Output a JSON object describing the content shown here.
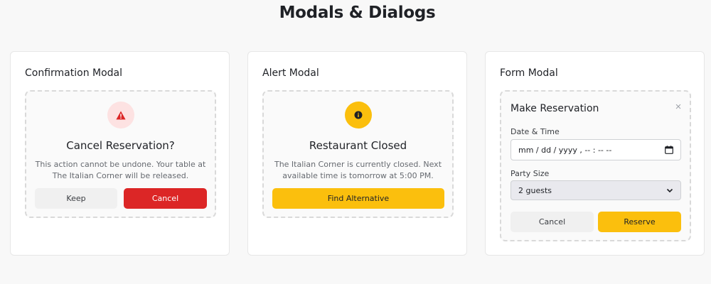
{
  "page": {
    "title": "Modals & Dialogs"
  },
  "confirmation": {
    "card_title": "Confirmation Modal",
    "icon": "warning-triangle-icon",
    "dialog_title": "Cancel Reservation?",
    "message": "This action cannot be undone. Your table at The Italian Corner will be released.",
    "keep_label": "Keep",
    "cancel_label": "Cancel",
    "colors": {
      "danger": "#dc2626",
      "icon_bg": "#fde2e2"
    }
  },
  "alert": {
    "card_title": "Alert Modal",
    "icon": "info-icon",
    "dialog_title": "Restaurant Closed",
    "message": "The Italian Corner is currently closed. Next available time is tomorrow at 5:00 PM.",
    "action_label": "Find Alternative",
    "colors": {
      "accent": "#fbbf0d"
    }
  },
  "form": {
    "card_title": "Form Modal",
    "dialog_title": "Make Reservation",
    "close_icon": "close-icon",
    "date_label": "Date & Time",
    "date_value": "mm / dd / yyyy ,  -- : --  --",
    "party_label": "Party Size",
    "party_value": "2 guests",
    "cancel_label": "Cancel",
    "reserve_label": "Reserve"
  }
}
